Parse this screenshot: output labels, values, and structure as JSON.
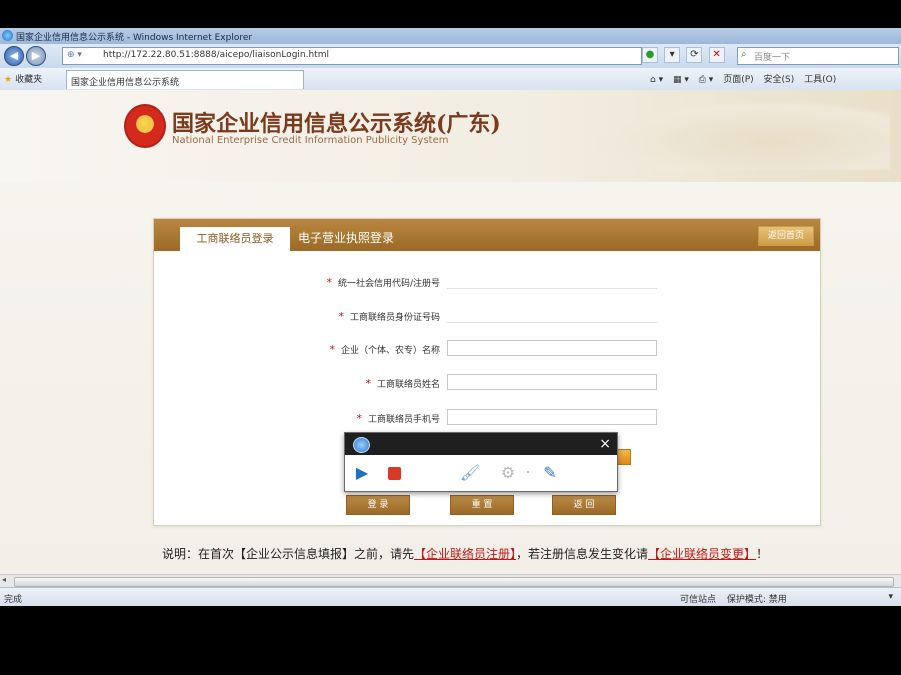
{
  "browser": {
    "window_title": "国家企业信用信息公示系统 - Windows Internet Explorer",
    "address": "http://172.22.80.51:8888/aicepo/liaisonLogin.html",
    "search_placeholder": "百度一下",
    "favorites_label": "收藏夹",
    "tab_title": "国家企业信用信息公示系统",
    "commands": [
      "页面(P)",
      "安全(S)",
      "工具(O)"
    ],
    "status_text": "完成",
    "status_zone": "可信站点",
    "status_protect": "保护模式: 禁用",
    "zoom": "▾"
  },
  "header": {
    "title_cn": "国家企业信用信息公示系统(广东)",
    "title_en": "National Enterprise Credit Information Publicity System"
  },
  "login": {
    "tabs": [
      "工商联络员登录",
      "电子营业执照登录"
    ],
    "back_label": "返回首页",
    "required_mark": "*",
    "fields": [
      {
        "label": "统一社会信用代码/注册号",
        "value": ""
      },
      {
        "label": "工商联络员身份证号码",
        "value": ""
      },
      {
        "label": "企业（个体、农专）名称",
        "value": ""
      },
      {
        "label": "工商联络员姓名",
        "value": ""
      },
      {
        "label": "工商联络员手机号",
        "value": ""
      }
    ],
    "buttons": [
      "登 录",
      "重 置",
      "返 回"
    ]
  },
  "note": {
    "prefix": "说明：在首次【企业公示信息填报】之前，请先",
    "link1": "【企业联络员注册】",
    "middle": "，若注册信息发生变化请",
    "link2": "【企业联络员变更】",
    "suffix": "！"
  },
  "recorder": {
    "close": "×",
    "tools": [
      "play-icon",
      "stop-icon",
      "brush-icon",
      "gear-icon",
      "pen-icon"
    ]
  },
  "colors": {
    "panel_header": "#9a6a26",
    "title": "#7a3a1d",
    "required": "#c0131d",
    "link": "#c01818"
  }
}
